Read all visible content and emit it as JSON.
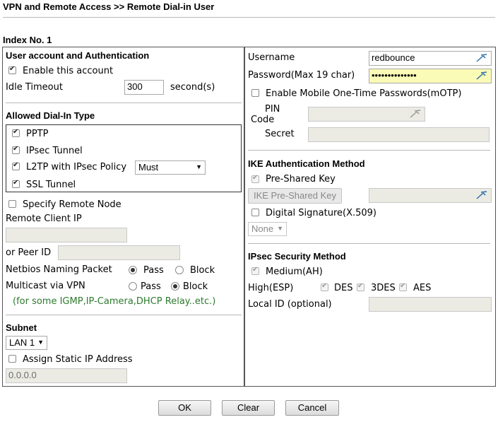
{
  "header": {
    "title": "VPN and Remote Access >> Remote Dial-in User"
  },
  "index_label": "Index No. 1",
  "left": {
    "account_section": "User account and Authentication",
    "enable_account": "Enable this account",
    "idle_timeout_label": "Idle Timeout",
    "idle_timeout_value": "300",
    "idle_timeout_unit": "second(s)",
    "dialin_section": "Allowed Dial-In Type",
    "pptp": "PPTP",
    "ipsec_tunnel": "IPsec Tunnel",
    "l2tp": "L2TP with IPsec Policy",
    "l2tp_policy": "Must",
    "ssl_tunnel": "SSL Tunnel",
    "specify_remote_node": "Specify Remote Node",
    "remote_client_ip": "Remote Client IP",
    "or_peer_id": "or Peer ID",
    "netbios": "Netbios Naming Packet",
    "multicast": "Multicast via VPN",
    "pass": "Pass",
    "block": "Block",
    "multicast_note": "(for some IGMP,IP-Camera,DHCP Relay..etc.)",
    "subnet_section": "Subnet",
    "subnet_value": "LAN 1",
    "assign_static": "Assign Static IP Address",
    "static_ip_value": "0.0.0.0"
  },
  "right": {
    "username_label": "Username",
    "username_value": "redbounce",
    "password_label": "Password(Max 19 char)",
    "password_value": "••••••••••••••",
    "motp": "Enable Mobile One-Time Passwords(mOTP)",
    "pin": "PIN",
    "code": "Code",
    "secret": "Secret",
    "ike_section": "IKE Authentication Method",
    "pre_shared_key": "Pre-Shared Key",
    "ike_psk_button": "IKE Pre-Shared Key",
    "digital_signature": "Digital Signature(X.509)",
    "ds_select": "None",
    "ipsec_section": "IPsec Security Method",
    "medium": "Medium(AH)",
    "high": "High(ESP)",
    "des": "DES",
    "des3": "3DES",
    "aes": "AES",
    "local_id": "Local ID (optional)"
  },
  "buttons": {
    "ok": "OK",
    "clear": "Clear",
    "cancel": "Cancel"
  },
  "colors": {
    "note_green": "#2d7a2d",
    "password_bg": "#fbfbb8",
    "key_icon": "#2a6fa8"
  }
}
